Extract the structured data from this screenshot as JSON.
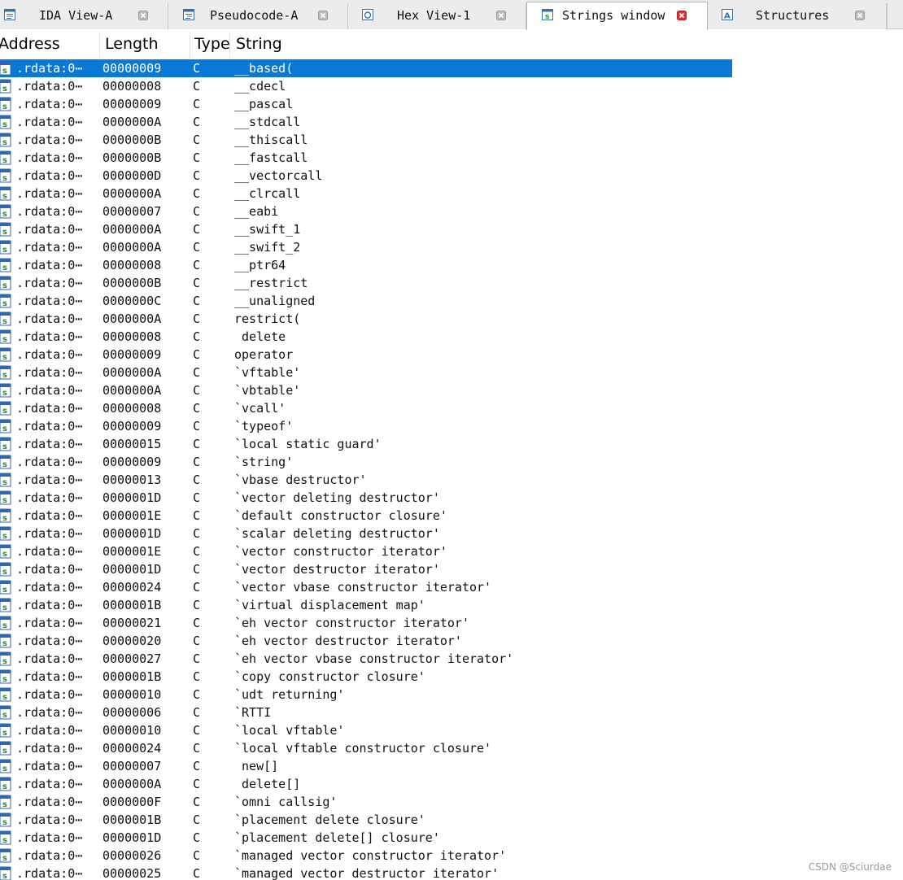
{
  "tabs": [
    {
      "label": "IDA View-A",
      "icon": "ida-view-icon",
      "active": false
    },
    {
      "label": "Pseudocode-A",
      "icon": "pseudocode-icon",
      "active": false
    },
    {
      "label": "Hex View-1",
      "icon": "hex-view-icon",
      "active": false
    },
    {
      "label": "Strings window",
      "icon": "strings-window-icon",
      "active": true
    },
    {
      "label": "Structures",
      "icon": "structures-icon",
      "active": false
    }
  ],
  "colors": {
    "selection": "#0a78d7",
    "close_active": "#e03030",
    "row_icon": "#2e8a2e"
  },
  "columns": {
    "address": "Address",
    "length": "Length",
    "type": "Type",
    "string": "String"
  },
  "rows": [
    {
      "address": ".rdata:0⋯",
      "length": "00000009",
      "type": "C",
      "string": "__based("
    },
    {
      "address": ".rdata:0⋯",
      "length": "00000008",
      "type": "C",
      "string": "__cdecl"
    },
    {
      "address": ".rdata:0⋯",
      "length": "00000009",
      "type": "C",
      "string": "__pascal"
    },
    {
      "address": ".rdata:0⋯",
      "length": "0000000A",
      "type": "C",
      "string": "__stdcall"
    },
    {
      "address": ".rdata:0⋯",
      "length": "0000000B",
      "type": "C",
      "string": "__thiscall"
    },
    {
      "address": ".rdata:0⋯",
      "length": "0000000B",
      "type": "C",
      "string": "__fastcall"
    },
    {
      "address": ".rdata:0⋯",
      "length": "0000000D",
      "type": "C",
      "string": "__vectorcall"
    },
    {
      "address": ".rdata:0⋯",
      "length": "0000000A",
      "type": "C",
      "string": "__clrcall"
    },
    {
      "address": ".rdata:0⋯",
      "length": "00000007",
      "type": "C",
      "string": "__eabi"
    },
    {
      "address": ".rdata:0⋯",
      "length": "0000000A",
      "type": "C",
      "string": "__swift_1"
    },
    {
      "address": ".rdata:0⋯",
      "length": "0000000A",
      "type": "C",
      "string": "__swift_2"
    },
    {
      "address": ".rdata:0⋯",
      "length": "00000008",
      "type": "C",
      "string": "__ptr64"
    },
    {
      "address": ".rdata:0⋯",
      "length": "0000000B",
      "type": "C",
      "string": "__restrict"
    },
    {
      "address": ".rdata:0⋯",
      "length": "0000000C",
      "type": "C",
      "string": "__unaligned"
    },
    {
      "address": ".rdata:0⋯",
      "length": "0000000A",
      "type": "C",
      "string": "restrict("
    },
    {
      "address": ".rdata:0⋯",
      "length": "00000008",
      "type": "C",
      "string": " delete"
    },
    {
      "address": ".rdata:0⋯",
      "length": "00000009",
      "type": "C",
      "string": "operator"
    },
    {
      "address": ".rdata:0⋯",
      "length": "0000000A",
      "type": "C",
      "string": "`vftable'"
    },
    {
      "address": ".rdata:0⋯",
      "length": "0000000A",
      "type": "C",
      "string": "`vbtable'"
    },
    {
      "address": ".rdata:0⋯",
      "length": "00000008",
      "type": "C",
      "string": "`vcall'"
    },
    {
      "address": ".rdata:0⋯",
      "length": "00000009",
      "type": "C",
      "string": "`typeof'"
    },
    {
      "address": ".rdata:0⋯",
      "length": "00000015",
      "type": "C",
      "string": "`local static guard'"
    },
    {
      "address": ".rdata:0⋯",
      "length": "00000009",
      "type": "C",
      "string": "`string'"
    },
    {
      "address": ".rdata:0⋯",
      "length": "00000013",
      "type": "C",
      "string": "`vbase destructor'"
    },
    {
      "address": ".rdata:0⋯",
      "length": "0000001D",
      "type": "C",
      "string": "`vector deleting destructor'"
    },
    {
      "address": ".rdata:0⋯",
      "length": "0000001E",
      "type": "C",
      "string": "`default constructor closure'"
    },
    {
      "address": ".rdata:0⋯",
      "length": "0000001D",
      "type": "C",
      "string": "`scalar deleting destructor'"
    },
    {
      "address": ".rdata:0⋯",
      "length": "0000001E",
      "type": "C",
      "string": "`vector constructor iterator'"
    },
    {
      "address": ".rdata:0⋯",
      "length": "0000001D",
      "type": "C",
      "string": "`vector destructor iterator'"
    },
    {
      "address": ".rdata:0⋯",
      "length": "00000024",
      "type": "C",
      "string": "`vector vbase constructor iterator'"
    },
    {
      "address": ".rdata:0⋯",
      "length": "0000001B",
      "type": "C",
      "string": "`virtual displacement map'"
    },
    {
      "address": ".rdata:0⋯",
      "length": "00000021",
      "type": "C",
      "string": "`eh vector constructor iterator'"
    },
    {
      "address": ".rdata:0⋯",
      "length": "00000020",
      "type": "C",
      "string": "`eh vector destructor iterator'"
    },
    {
      "address": ".rdata:0⋯",
      "length": "00000027",
      "type": "C",
      "string": "`eh vector vbase constructor iterator'"
    },
    {
      "address": ".rdata:0⋯",
      "length": "0000001B",
      "type": "C",
      "string": "`copy constructor closure'"
    },
    {
      "address": ".rdata:0⋯",
      "length": "00000010",
      "type": "C",
      "string": "`udt returning'"
    },
    {
      "address": ".rdata:0⋯",
      "length": "00000006",
      "type": "C",
      "string": "`RTTI"
    },
    {
      "address": ".rdata:0⋯",
      "length": "00000010",
      "type": "C",
      "string": "`local vftable'"
    },
    {
      "address": ".rdata:0⋯",
      "length": "00000024",
      "type": "C",
      "string": "`local vftable constructor closure'"
    },
    {
      "address": ".rdata:0⋯",
      "length": "00000007",
      "type": "C",
      "string": " new[]"
    },
    {
      "address": ".rdata:0⋯",
      "length": "0000000A",
      "type": "C",
      "string": " delete[]"
    },
    {
      "address": ".rdata:0⋯",
      "length": "0000000F",
      "type": "C",
      "string": "`omni callsig'"
    },
    {
      "address": ".rdata:0⋯",
      "length": "0000001B",
      "type": "C",
      "string": "`placement delete closure'"
    },
    {
      "address": ".rdata:0⋯",
      "length": "0000001D",
      "type": "C",
      "string": "`placement delete[] closure'"
    },
    {
      "address": ".rdata:0⋯",
      "length": "00000026",
      "type": "C",
      "string": "`managed vector constructor iterator'"
    },
    {
      "address": ".rdata:0⋯",
      "length": "00000025",
      "type": "C",
      "string": "`managed vector destructor iterator'"
    }
  ],
  "selected_row": 0,
  "watermark": "CSDN @Sciurdae"
}
